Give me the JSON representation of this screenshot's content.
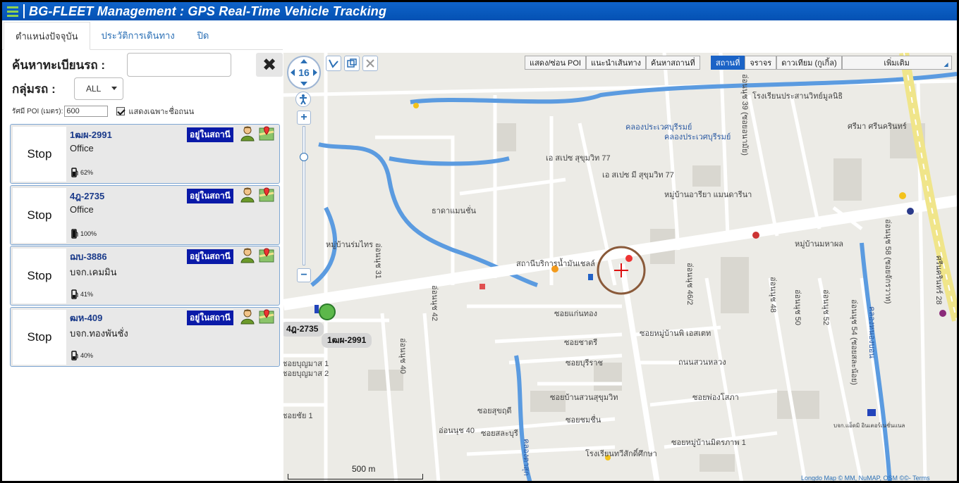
{
  "header": {
    "title": "BG-FLEET Management : GPS Real-Time Vehicle Tracking"
  },
  "tabs": [
    {
      "label": "ตำแหน่งปัจจุบัน",
      "active": true
    },
    {
      "label": "ประวัติการเดินทาง",
      "active": false
    },
    {
      "label": "ปิด",
      "active": false
    }
  ],
  "search": {
    "plate_label": "ค้นหาทะเบียนรถ :",
    "plate_value": "",
    "group_label": "กลุ่มรถ :",
    "group_selected": "ALL",
    "poi_radius_label": "รัศมี POI (เมตร):",
    "poi_radius_value": "600",
    "road_only_label": "แสดงเฉพาะชื่อถนน",
    "road_only_checked": true
  },
  "vehicles": [
    {
      "status_button": "Stop",
      "plate": "1ฒผ-2991",
      "location": "Office",
      "badge": "อยู่ในสถานี",
      "fuel": "62%",
      "fuel_level": 0.62
    },
    {
      "status_button": "Stop",
      "plate": "4ฎ-2735",
      "location": "Office",
      "badge": "อยู่ในสถานี",
      "fuel": "100%",
      "fuel_level": 1.0
    },
    {
      "status_button": "Stop",
      "plate": "ฌบ-3886",
      "location": "บจก.เคมมิน",
      "badge": "อยู่ในสถานี",
      "fuel": "41%",
      "fuel_level": 0.41
    },
    {
      "status_button": "Stop",
      "plate": "ฒห-409",
      "location": "บจก.ทองพันชั่ง",
      "badge": "อยู่ในสถานี",
      "fuel": "40%",
      "fuel_level": 0.4
    }
  ],
  "map": {
    "zoom_level": "16",
    "toolbar_left": [
      "แสดง/ซ่อน POI",
      "แนะนำเส้นทาง",
      "ค้นหาสถานที่"
    ],
    "map_types": [
      {
        "label": "สถานที่",
        "selected": true
      },
      {
        "label": "จราจร",
        "selected": false
      },
      {
        "label": "ดาวเทียม (กูเกิ้ล)",
        "selected": false
      }
    ],
    "more_label": "เพิ่มเติม",
    "scale_label": "500 m",
    "attribution": "Longdo Map © MM, NuMAP, OSM ©©- Terms",
    "vehicle_tags": [
      "4ฎ-2735",
      "1ฒผ-2991"
    ],
    "labels": [
      "โรงเรียนประสานวิทย์มูลนิธิ",
      "คลองประเวศบุรีรมย์",
      "คลองประเวศบุรีรมย์",
      "เอ สเปซ สุขุมวิท 77",
      "เอ สเปซ มี สุขุมวิท 77",
      "หมู่บ้านอารียา แมนดารีนา",
      "ธาดาแมนชั่น",
      "หมู่บ้านร่มไทร",
      "สถานีบริการน้ำมันเชลล์",
      "ซอยแก่นทอง",
      "ซอยชาตรี",
      "ซอยบุรีราช",
      "ซอยบ้านสวนสุขุมวิท",
      "ซอยหมู่บ้านพิ เอสเตท",
      "ถนนสวนหลวง",
      "ซอยพ่องโสภา",
      "ซอยบุญมาส 1",
      "ซอยบุญมาส 2",
      "ซอยสุขฤดี",
      "ซอยสละบุรี",
      "ซอยชมชื่น",
      "อ่อนนุช 40",
      "ซอยหมู่บ้านมิตรภาพ 1",
      "โรงเรียนทวีสักดิ์ศึกษา",
      "หมู่บ้านมหาผล",
      "บจก.แอ็ดมิ อินเตอร์เนชั่นแนล",
      "ศรีมา ศรีนครินทร์",
      "ซอยชัย 1"
    ],
    "vertical_labels": [
      "อ่อนนุช 39 (ซอยอนามัย)",
      "อ่อนนุช 46/2",
      "อ่อนนุช 48",
      "อ่อนนุช 50",
      "อ่อนนุช 52",
      "อ่อนนุช 54 (ซอยสละน้อย)",
      "อ่อนนุช 58 (ซอยจักรวาท)",
      "ศรีนครินทร์ 28",
      "อ่อนนุช 42",
      "อ่อนนุช 40",
      "อ่อนนุช 31",
      "คลองหนองบอน",
      "คลองตาสุก"
    ]
  }
}
